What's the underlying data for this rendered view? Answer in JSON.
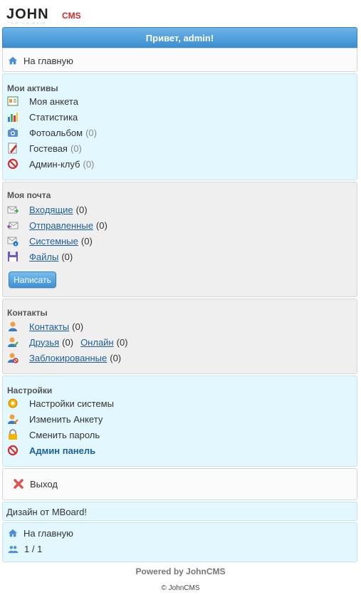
{
  "logo": {
    "main": "JOHN",
    "sub": "CMS"
  },
  "header": {
    "greeting": "Привет, admin!"
  },
  "nav_top": {
    "home": "На главную"
  },
  "assets": {
    "title": "Мои активы",
    "profile": "Моя анкета",
    "stats": "Статистика",
    "album": "Фотоальбом",
    "album_count": "(0)",
    "guest": "Гостевая",
    "guest_count": "(0)",
    "admin_club": "Админ-клуб",
    "admin_club_count": "(0)"
  },
  "mail": {
    "title": "Моя почта",
    "inbox": "Входящие",
    "inbox_count": "(0)",
    "sent": "Отправленные",
    "sent_count": "(0)",
    "system": "Системные",
    "system_count": "(0)",
    "files": "Файлы",
    "files_count": "(0)",
    "write_button": "Написать"
  },
  "contacts": {
    "title": "Контакты",
    "contacts": "Контакты",
    "contacts_count": "(0)",
    "friends": "Друзья",
    "friends_count": "(0)",
    "online": "Онлайн",
    "online_count": "(0)",
    "blocked": "Заблокированные",
    "blocked_count": "(0)"
  },
  "settings": {
    "title": "Настройки",
    "system": "Настройки системы",
    "edit_profile": "Изменить Анкету",
    "change_password": "Сменить пароль",
    "admin_panel": "Админ панель"
  },
  "logout": {
    "label": "Выход"
  },
  "design": {
    "text": "Дизайн от MBoard!"
  },
  "nav_bottom": {
    "home": "На главную",
    "online": "1 / 1"
  },
  "footer": {
    "powered": "Powered by JohnCMS",
    "copyright": "© JohnCMS"
  }
}
